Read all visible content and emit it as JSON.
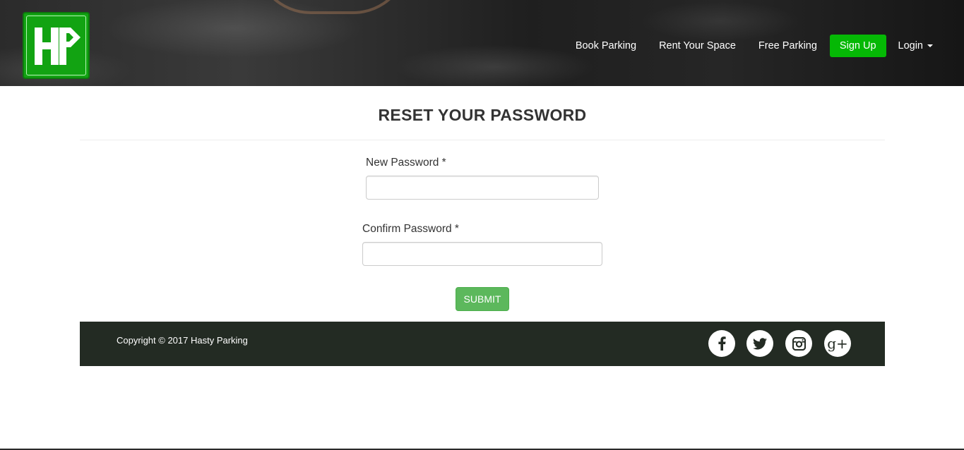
{
  "brand": {
    "logo_text": "HP",
    "colors": {
      "accent": "#05b805",
      "logo": "#12a312",
      "footer_bg": "#232b23",
      "submit": "#5cb85c"
    }
  },
  "nav": {
    "items": [
      {
        "label": "Book Parking"
      },
      {
        "label": "Rent Your Space"
      },
      {
        "label": "Free Parking"
      }
    ],
    "signup_label": "Sign Up",
    "login_label": "Login"
  },
  "form": {
    "title": "RESET YOUR PASSWORD",
    "new_password": {
      "label": "New Password *",
      "value": "",
      "placeholder": ""
    },
    "confirm_password": {
      "label": "Confirm Password *",
      "value": "",
      "placeholder": ""
    },
    "submit_label": "SUBMIT"
  },
  "footer": {
    "copyright": "Copyright © 2017 Hasty Parking",
    "social_icons": [
      "facebook-icon",
      "twitter-icon",
      "instagram-icon",
      "google-plus-icon"
    ],
    "gplus_glyph": "g+"
  }
}
